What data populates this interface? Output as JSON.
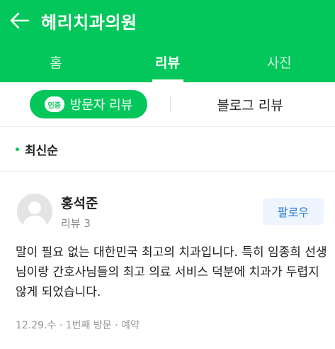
{
  "header": {
    "title": "헤리치과의원",
    "back_icon": "arrow-left-icon"
  },
  "tabs": [
    {
      "label": "홈",
      "active": false
    },
    {
      "label": "리뷰",
      "active": true
    },
    {
      "label": "사진",
      "active": false
    }
  ],
  "filter": {
    "badge": "인증",
    "visitor_review_label": "방문자 리뷰",
    "blog_review_label": "블로그 리뷰"
  },
  "sort": {
    "label": "최신순"
  },
  "review": {
    "author_name": "홍석준",
    "author_meta": "리뷰 3",
    "follow_label": "팔로우",
    "text": "말이 필요 없는 대한민국 최고의 치과입니다. 특히 임종희 선생님이랑 간호사님들의 최고 의료 서비스 덕분에 치과가 두렵지 않게 되었습니다.",
    "info": "12.29.수 · 1번째 방문 · 예약"
  },
  "colors": {
    "brand_green": "#03c75a",
    "follow_blue": "#2c7bd6",
    "follow_bg": "#eef5ff"
  }
}
